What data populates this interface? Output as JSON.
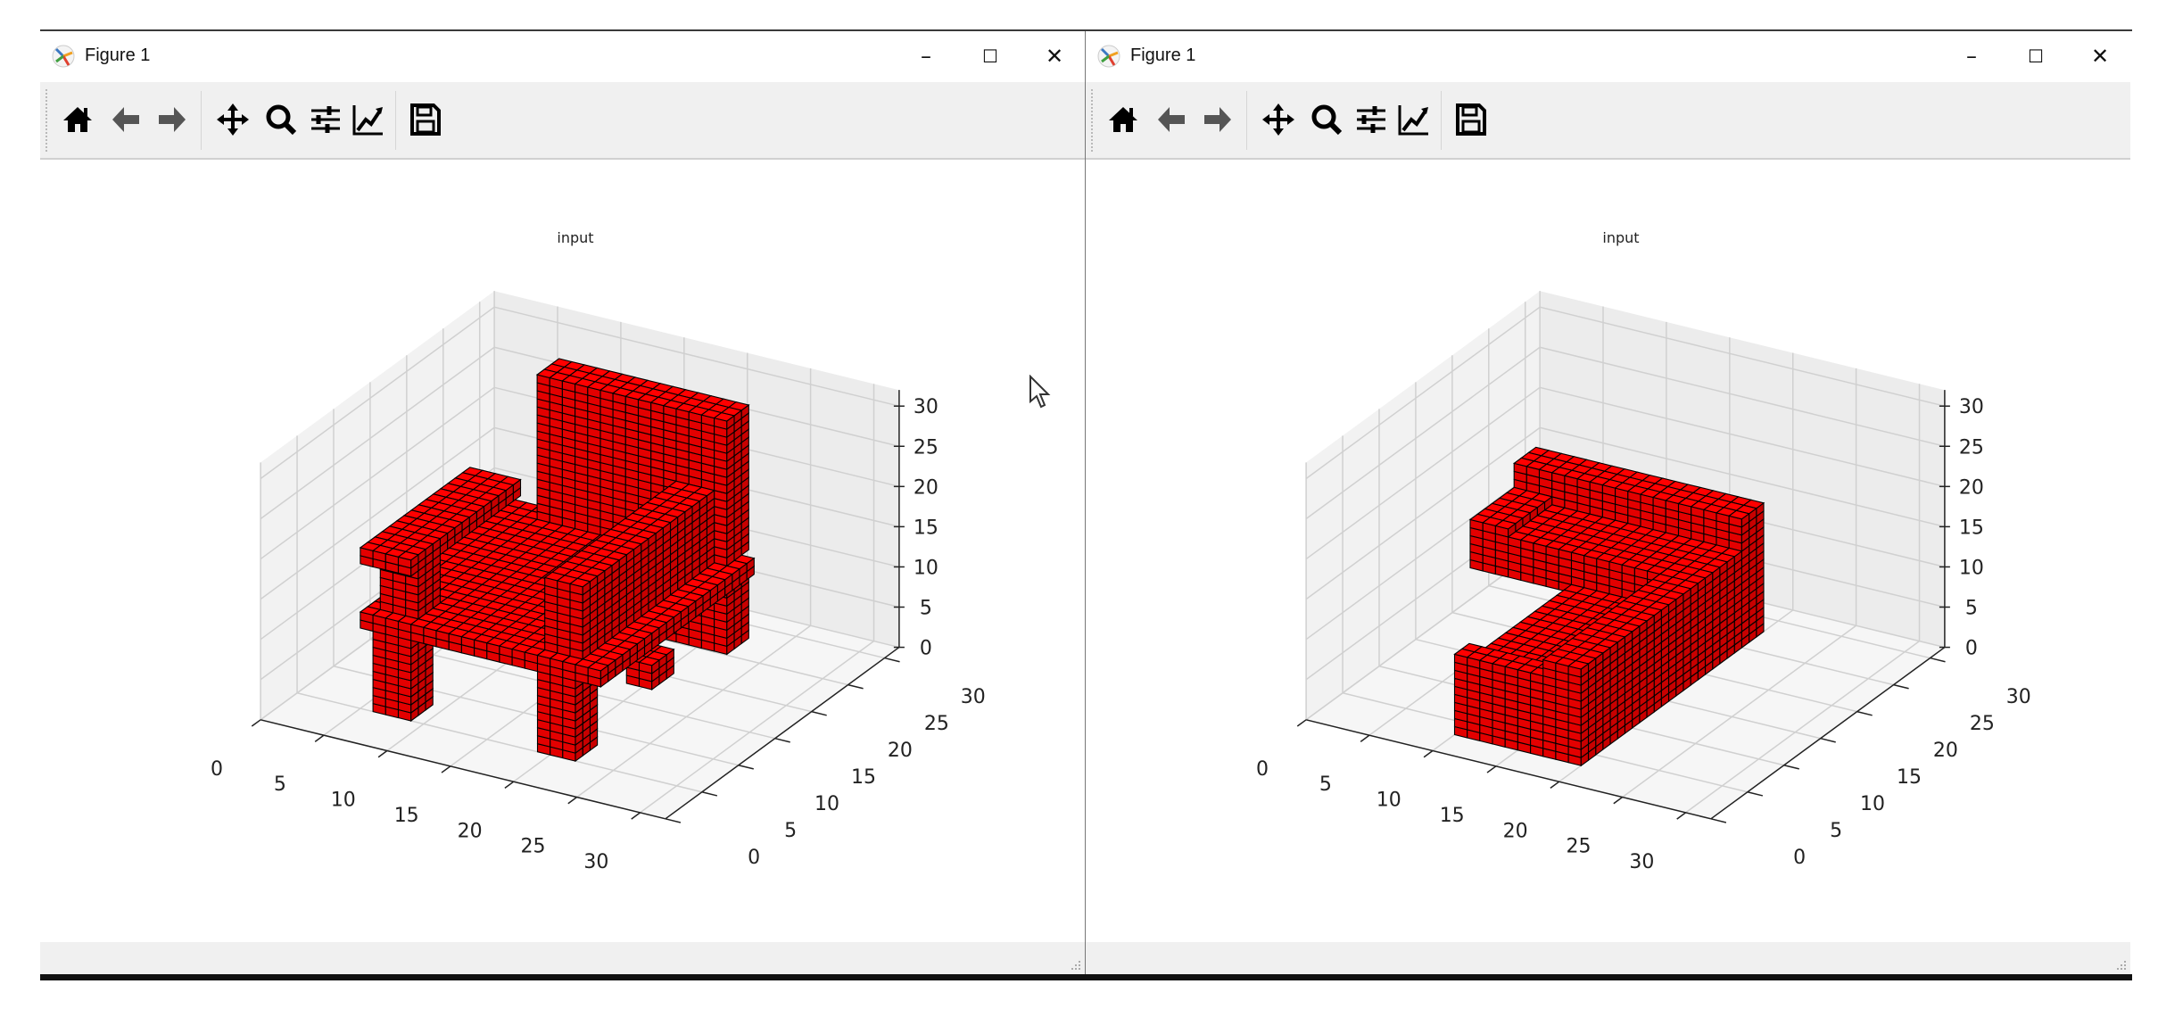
{
  "windows": [
    {
      "title": "Figure 1",
      "controls": {
        "minimize": "–",
        "maximize": "☐",
        "close": "✕"
      },
      "toolbar": [
        "home-icon",
        "back-arrow-icon",
        "forward-arrow-icon",
        "pan-icon",
        "zoom-icon",
        "subplots-icon",
        "customize-icon",
        "save-icon"
      ]
    },
    {
      "title": "Figure 1",
      "controls": {
        "minimize": "–",
        "maximize": "☐",
        "close": "✕"
      },
      "toolbar": [
        "home-icon",
        "back-arrow-icon",
        "forward-arrow-icon",
        "pan-icon",
        "zoom-icon",
        "subplots-icon",
        "customize-icon",
        "save-icon"
      ]
    }
  ],
  "chart_data": [
    {
      "type": "voxels3d",
      "title": "input",
      "xlim": [
        0,
        32
      ],
      "ylim": [
        0,
        32
      ],
      "zlim": [
        0,
        32
      ],
      "xticks": [
        0,
        5,
        10,
        15,
        20,
        25,
        30
      ],
      "yticks": [
        0,
        5,
        10,
        15,
        20,
        25,
        30
      ],
      "zticks": [
        0,
        5,
        10,
        15,
        20,
        25,
        30
      ],
      "view": {
        "elev": 30,
        "azim": -60
      },
      "facecolor": "#ff0000",
      "edgecolor": "#000000",
      "object": "chair",
      "boxes": [
        [
          6,
          9,
          5,
          8,
          0,
          10
        ],
        [
          19,
          22,
          5,
          8,
          0,
          10
        ],
        [
          8,
          23,
          24,
          27,
          1,
          10
        ],
        [
          5,
          24,
          5,
          26,
          10,
          12
        ],
        [
          8,
          23,
          24,
          27,
          12,
          30
        ],
        [
          5,
          9,
          5,
          20,
          18,
          20
        ],
        [
          6,
          9,
          6,
          9,
          12,
          18
        ],
        [
          19,
          22,
          6,
          26,
          12,
          21
        ],
        [
          22,
          24,
          12,
          15,
          5,
          8
        ]
      ]
    },
    {
      "type": "voxels3d",
      "title": "input",
      "xlim": [
        0,
        32
      ],
      "ylim": [
        0,
        32
      ],
      "zlim": [
        0,
        32
      ],
      "xticks": [
        0,
        5,
        10,
        15,
        20,
        25,
        30
      ],
      "yticks": [
        0,
        5,
        10,
        15,
        20,
        25,
        30
      ],
      "zticks": [
        0,
        5,
        10,
        15,
        20,
        25,
        30
      ],
      "view": {
        "elev": 30,
        "azim": -60
      },
      "facecolor": "#ff0000",
      "edgecolor": "#000000",
      "object": "sofa",
      "boxes": [
        [
          10,
          20,
          3,
          28,
          0,
          8
        ],
        [
          17,
          20,
          3,
          28,
          8,
          12
        ],
        [
          10,
          17,
          3,
          5,
          8,
          10
        ],
        [
          2,
          17,
          19,
          28,
          7,
          12
        ],
        [
          2,
          20,
          25,
          28,
          12,
          16
        ],
        [
          2,
          5,
          19,
          25,
          12,
          13
        ]
      ]
    }
  ]
}
